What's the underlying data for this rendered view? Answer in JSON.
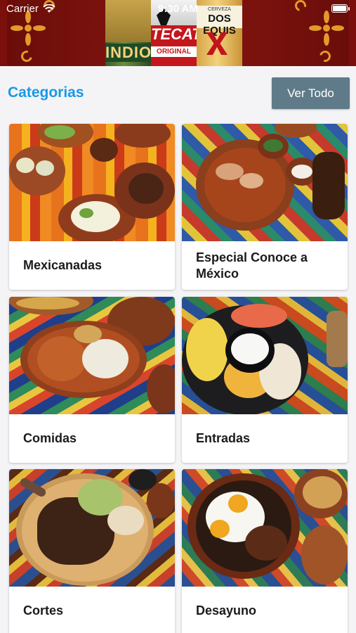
{
  "status_bar": {
    "carrier": "Carrier",
    "time": "9:30 AM"
  },
  "banner": {
    "bottles": [
      {
        "brand": "INDIO"
      },
      {
        "brand": "TECATE",
        "sub": "ORIGINAL"
      },
      {
        "top": "CERVEZA",
        "brand": "DOS EQUIS"
      }
    ]
  },
  "section": {
    "title": "Categorias",
    "view_all_label": "Ver Todo"
  },
  "categories": [
    {
      "name": "Mexicanadas"
    },
    {
      "name": "Especial Conoce a México"
    },
    {
      "name": "Comidas"
    },
    {
      "name": "Entradas"
    },
    {
      "name": "Cortes"
    },
    {
      "name": "Desayuno"
    }
  ],
  "colors": {
    "accent": "#1a98e6",
    "button": "#5f7b89",
    "banner": "#7a0f0c"
  }
}
